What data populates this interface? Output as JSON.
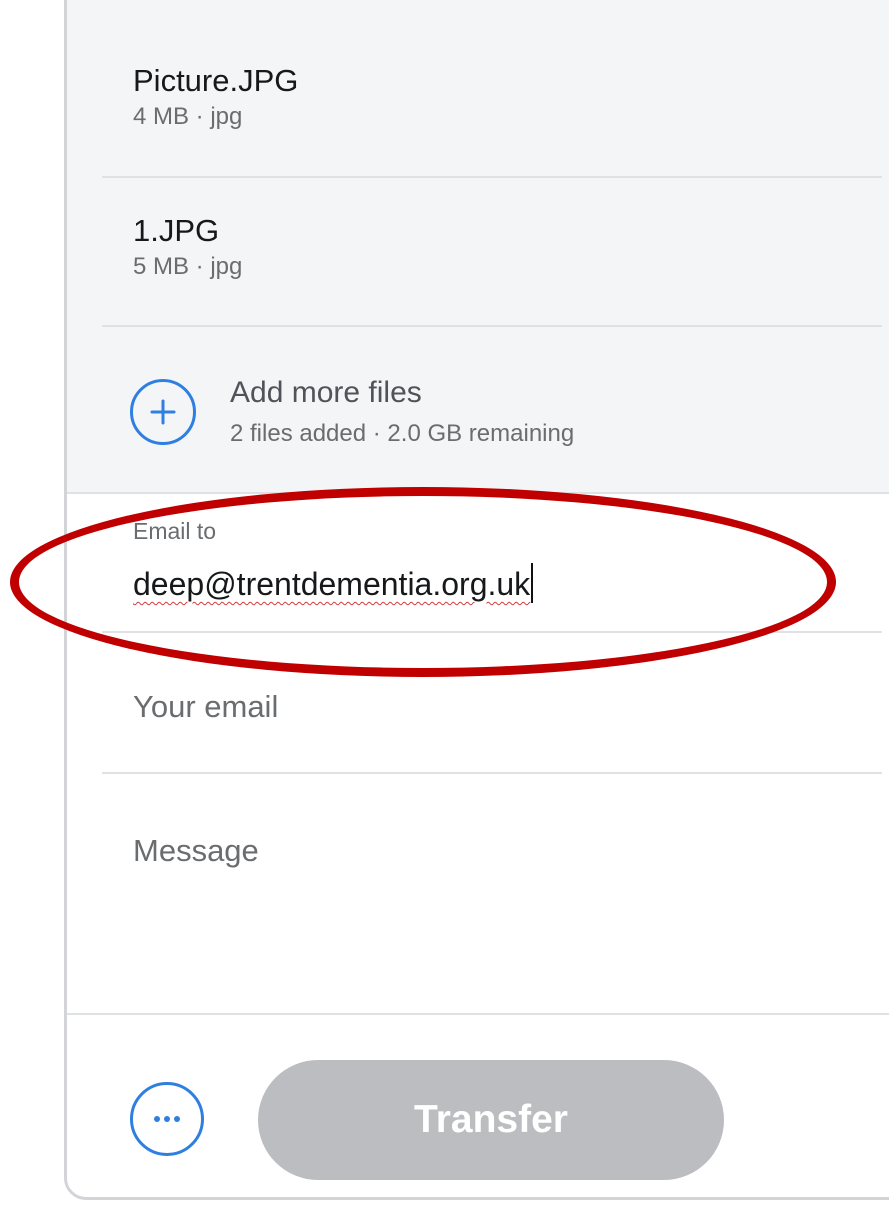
{
  "files": [
    {
      "name": "Picture.JPG",
      "meta": "4 MB · jpg"
    },
    {
      "name": "1.JPG",
      "meta": "5 MB · jpg"
    }
  ],
  "add_more": {
    "label": "Add more files",
    "status": "2 files added · 2.0 GB remaining",
    "icon": "plus-circle-icon"
  },
  "form": {
    "email_to_label": "Email to",
    "email_to_value": "deep@trentdementia.org.uk",
    "your_email_placeholder": "Your email",
    "message_placeholder": "Message"
  },
  "actions": {
    "more_icon": "more-options-icon",
    "transfer_label": "Transfer"
  },
  "colors": {
    "accent": "#2f7fe0",
    "annotation": "#c00000",
    "button_disabled": "#bcbdc1"
  }
}
